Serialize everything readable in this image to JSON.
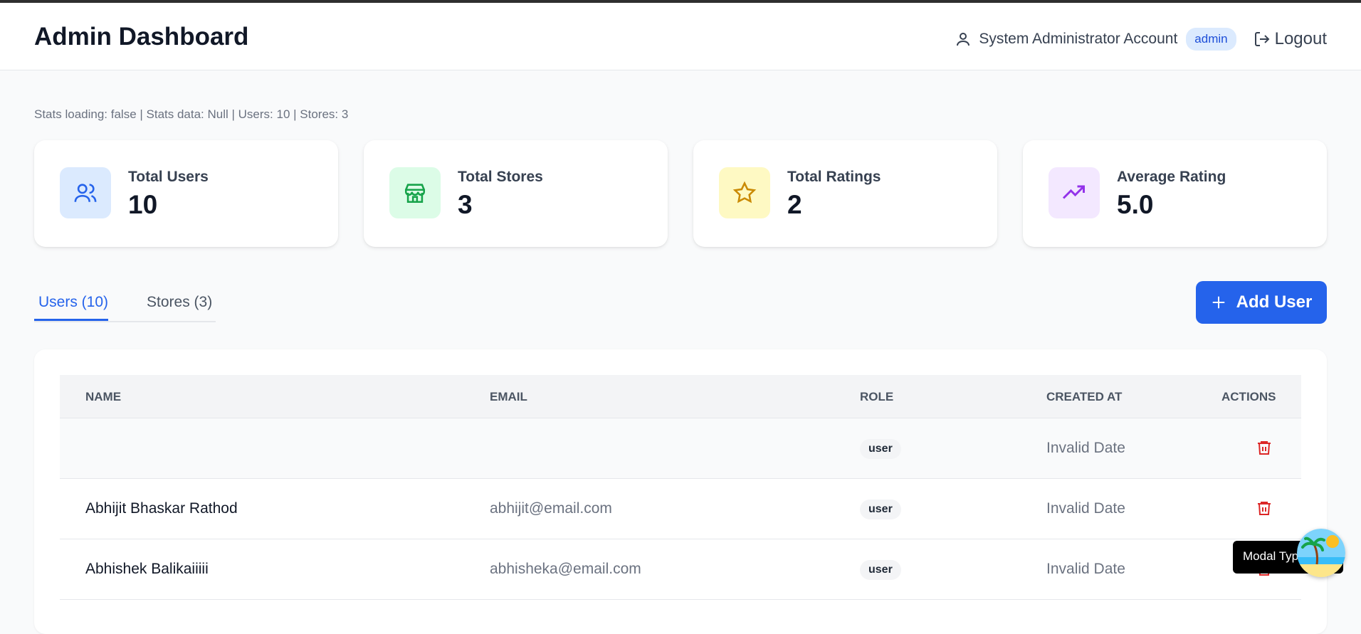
{
  "header": {
    "title": "Admin Dashboard",
    "user_name": "System Administrator Account",
    "role": "admin",
    "logout_label": "Logout"
  },
  "debug_text": "Stats loading: false | Stats data: Null | Users: 10 | Stores: 3",
  "stats": [
    {
      "label": "Total Users",
      "value": "10",
      "icon": "users-icon",
      "bg": "#dbeafe",
      "color": "#2563eb"
    },
    {
      "label": "Total Stores",
      "value": "3",
      "icon": "store-icon",
      "bg": "#dcfce7",
      "color": "#16a34a"
    },
    {
      "label": "Total Ratings",
      "value": "2",
      "icon": "star-icon",
      "bg": "#fef9c3",
      "color": "#ca8a04"
    },
    {
      "label": "Average Rating",
      "value": "5.0",
      "icon": "trending-up-icon",
      "bg": "#f3e8ff",
      "color": "#9333ea"
    }
  ],
  "tabs": [
    {
      "label": "Users (10)",
      "active": true
    },
    {
      "label": "Stores (3)",
      "active": false
    }
  ],
  "add_button_label": "Add User",
  "table": {
    "headers": [
      "NAME",
      "EMAIL",
      "ROLE",
      "CREATED AT",
      "ACTIONS"
    ],
    "rows": [
      {
        "name": "",
        "email": "",
        "role": "user",
        "created": "Invalid Date"
      },
      {
        "name": "Abhijit Bhaskar Rathod",
        "email": "abhijit@email.com",
        "role": "user",
        "created": "Invalid Date"
      },
      {
        "name": "Abhishek Balikaiiiii",
        "email": "abhisheka@email.com",
        "role": "user",
        "created": "Invalid Date"
      }
    ]
  },
  "toast_text": "Modal Type",
  "colors": {
    "accent": "#2563eb",
    "danger": "#dc2626"
  }
}
